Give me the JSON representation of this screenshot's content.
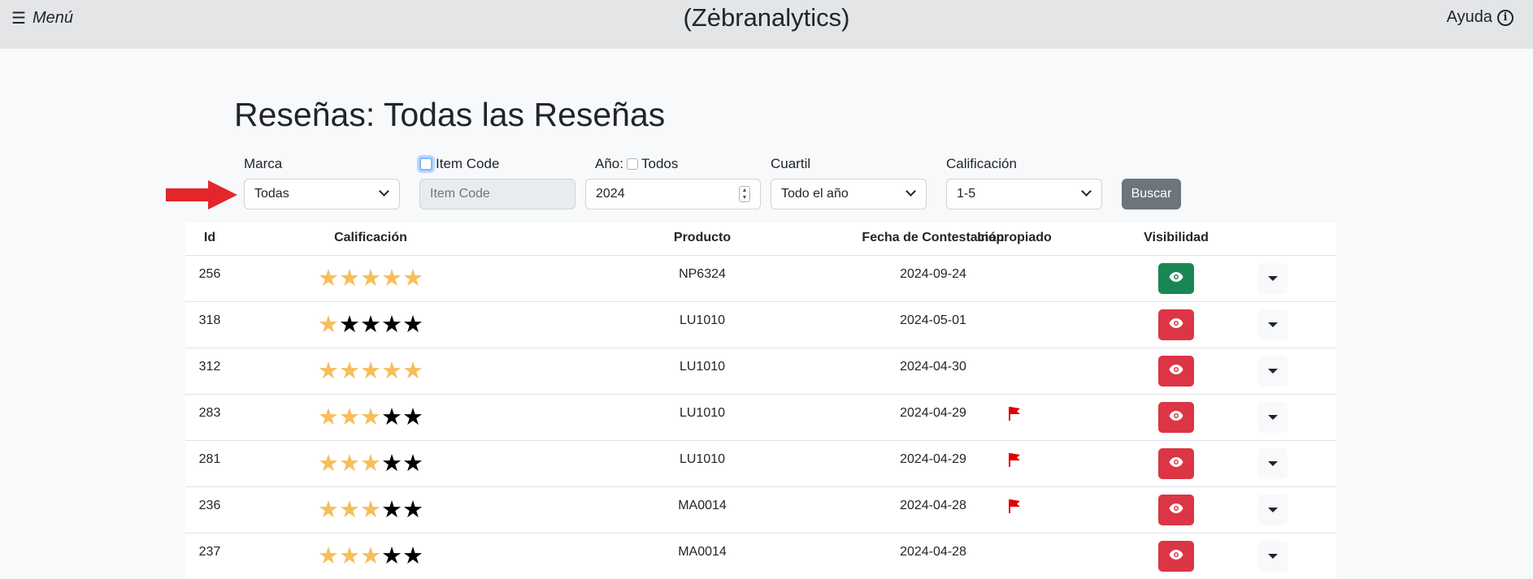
{
  "header": {
    "menu_label": "Menú",
    "brand": "(Zėbranalytics)",
    "help_label": "Ayuda"
  },
  "page_title": "Reseñas: Todas las Reseñas",
  "filters": {
    "marca_label": "Marca",
    "marca_value": "Todas",
    "item_code_label": "Item Code",
    "item_code_placeholder": "Item Code",
    "ano_label": "Año:",
    "todos_label": "Todos",
    "ano_value": "2024",
    "cuartil_label": "Cuartil",
    "cuartil_value": "Todo el año",
    "calificacion_label": "Calificación",
    "calificacion_value": "1-5",
    "buscar_label": "Buscar"
  },
  "table": {
    "headers": [
      "Id",
      "Calificación",
      "Producto",
      "Fecha de Contestación",
      "Inapropiado",
      "Visibilidad"
    ],
    "rows": [
      {
        "id": "256",
        "rating": 5,
        "producto": "NP6324",
        "fecha": "2024-09-24",
        "inapropiado": false,
        "visible": true
      },
      {
        "id": "318",
        "rating": 1,
        "producto": "LU1010",
        "fecha": "2024-05-01",
        "inapropiado": false,
        "visible": false
      },
      {
        "id": "312",
        "rating": 5,
        "producto": "LU1010",
        "fecha": "2024-04-30",
        "inapropiado": false,
        "visible": false
      },
      {
        "id": "283",
        "rating": 3,
        "producto": "LU1010",
        "fecha": "2024-04-29",
        "inapropiado": true,
        "visible": false
      },
      {
        "id": "281",
        "rating": 3,
        "producto": "LU1010",
        "fecha": "2024-04-29",
        "inapropiado": true,
        "visible": false
      },
      {
        "id": "236",
        "rating": 3,
        "producto": "MA0014",
        "fecha": "2024-04-28",
        "inapropiado": true,
        "visible": false
      },
      {
        "id": "237",
        "rating": 3,
        "producto": "MA0014",
        "fecha": "2024-04-28",
        "inapropiado": false,
        "visible": false
      }
    ]
  },
  "colors": {
    "star_on": "#f7be5b",
    "star_off": "#000000",
    "visible_green": "#198754",
    "hidden_red": "#dc3545",
    "flag_red": "#e00000",
    "arrow_red": "#e3262b"
  },
  "icons": {
    "menu": "hamburger-icon",
    "help": "info-icon",
    "visibility": "eye-icon",
    "inapropiado": "flag-icon",
    "row_action": "caret-down-icon",
    "annotation": "red-arrow-icon"
  }
}
